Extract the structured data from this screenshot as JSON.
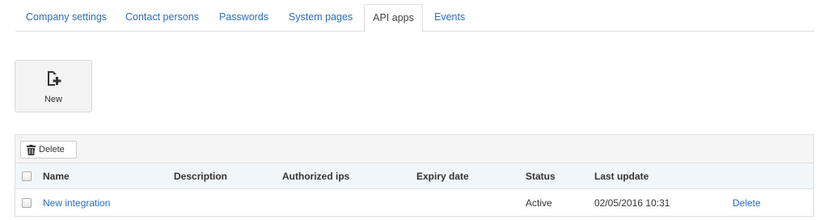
{
  "tabs": [
    {
      "label": "Company settings"
    },
    {
      "label": "Contact persons"
    },
    {
      "label": "Passwords"
    },
    {
      "label": "System pages"
    },
    {
      "label": "API apps",
      "active": true
    },
    {
      "label": "Events"
    }
  ],
  "new_button": {
    "label": "New",
    "icon": "new-document-plus-icon"
  },
  "toolbar": {
    "delete_label": "Delete",
    "delete_icon": "trash-icon"
  },
  "table": {
    "columns": [
      "Name",
      "Description",
      "Authorized ips",
      "Expiry date",
      "Status",
      "Last update"
    ],
    "rows": [
      {
        "name": "New integration",
        "description": "",
        "authorized_ips": "",
        "expiry_date": "",
        "status": "Active",
        "last_update": "02/05/2016 10:31",
        "action": "Delete"
      }
    ]
  },
  "colors": {
    "link": "#2a6ebb",
    "header_bg": "#f0f6fa",
    "toolbar_bg": "#f5f5f5",
    "border": "#dddddd"
  }
}
